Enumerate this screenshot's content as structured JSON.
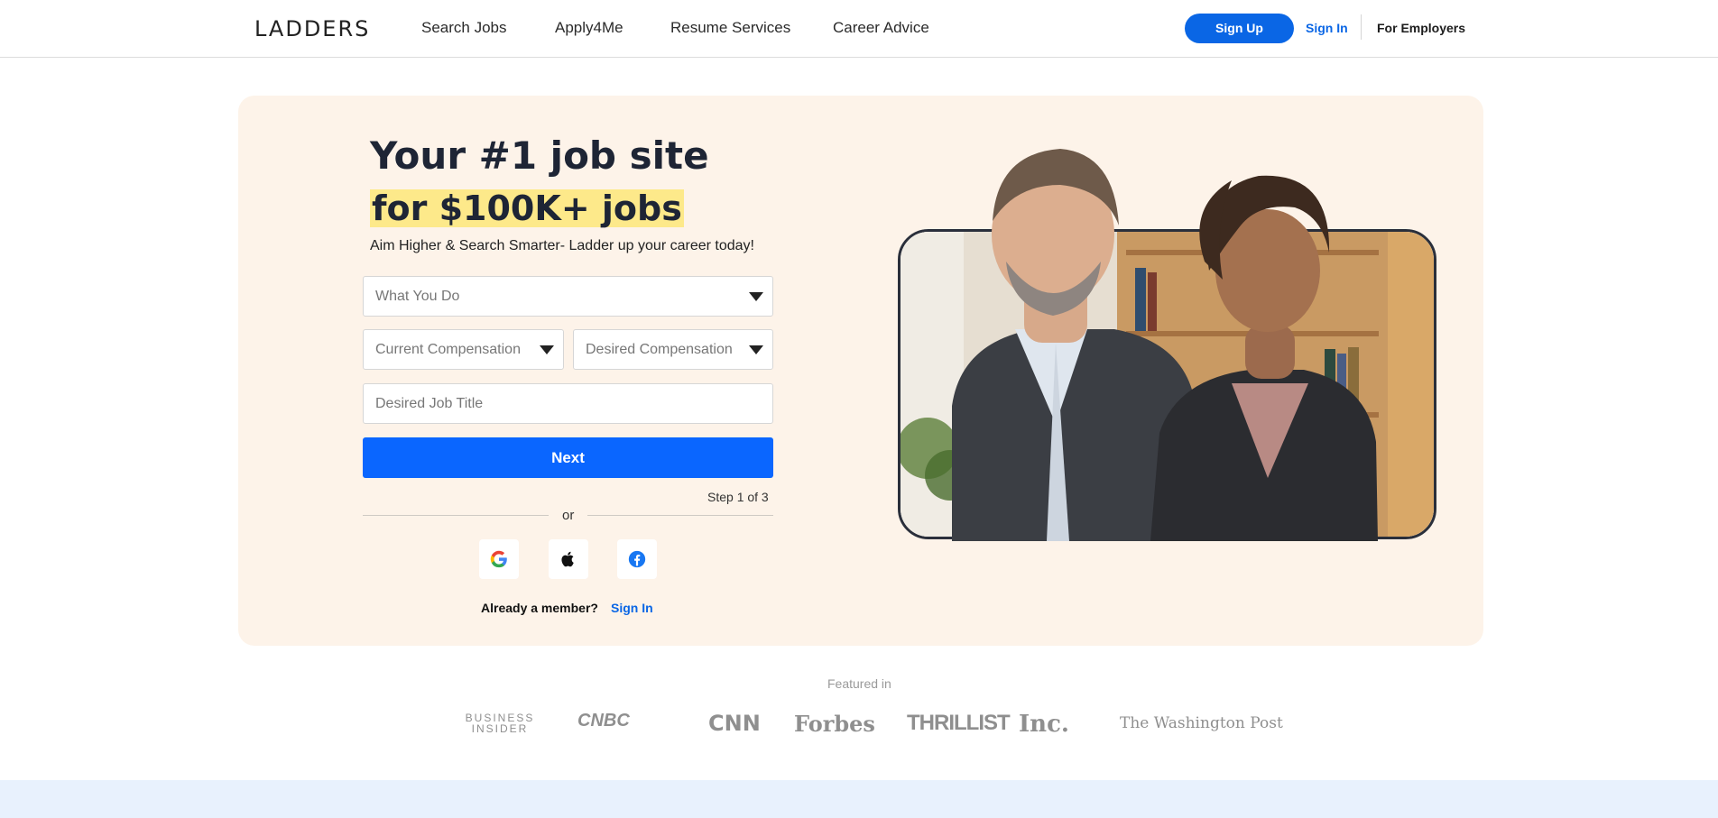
{
  "header": {
    "logo": "LADDERS",
    "nav": [
      "Search Jobs",
      "Apply4Me",
      "Resume Services",
      "Career Advice"
    ],
    "signup_label": "Sign Up",
    "signin_label": "Sign In",
    "employers_label": "For Employers"
  },
  "hero": {
    "title_line1": "Your #1 job site",
    "title_line2": "for $100K+ jobs",
    "subtitle": "Aim Higher & Search Smarter- Ladder up your career today!",
    "fields": {
      "what_you_do": "What You Do",
      "current_comp": "Current Compensation",
      "desired_comp": "Desired Compensation",
      "job_title_placeholder": "Desired Job Title"
    },
    "next_label": "Next",
    "step_text": "Step 1 of 3",
    "or_text": "or",
    "social_icons": [
      "google-icon",
      "apple-icon",
      "facebook-icon"
    ],
    "member_text": "Already a member?",
    "member_signin": "Sign In"
  },
  "featured": {
    "label": "Featured in",
    "logos": [
      "BUSINESS INSIDER",
      "CNBC",
      "CNN",
      "Forbes",
      "THRILLIST",
      "Inc.",
      "The Washington Post"
    ]
  },
  "colors": {
    "accent": "#0a66e5",
    "hero_bg": "#fdf3e9",
    "highlight": "#fde98a"
  }
}
